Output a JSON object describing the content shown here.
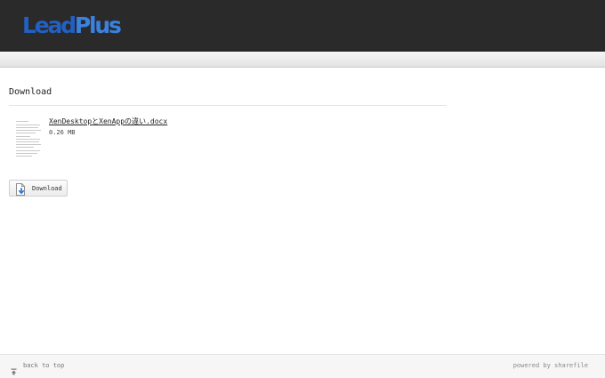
{
  "header": {
    "logo_lead": "Lead",
    "logo_plus": "Plus"
  },
  "main": {
    "title": "Download",
    "file": {
      "name": "XenDesktopとXenAppの違い.docx",
      "size": "0.26 MB",
      "thumbnail_icon": "document-thumbnail-icon"
    },
    "download_button": {
      "label": "Download",
      "icon": "download-file-icon"
    }
  },
  "footer": {
    "back_to_top": "back to top",
    "back_to_top_icon": "arrow-up-bar-icon",
    "powered_by": "powered by sharefile"
  },
  "colors": {
    "header_bg": "#2a2a2a",
    "logo_lead": "#2160c4",
    "logo_plus": "#3b82e0",
    "icon_blue": "#2f7bd8"
  }
}
